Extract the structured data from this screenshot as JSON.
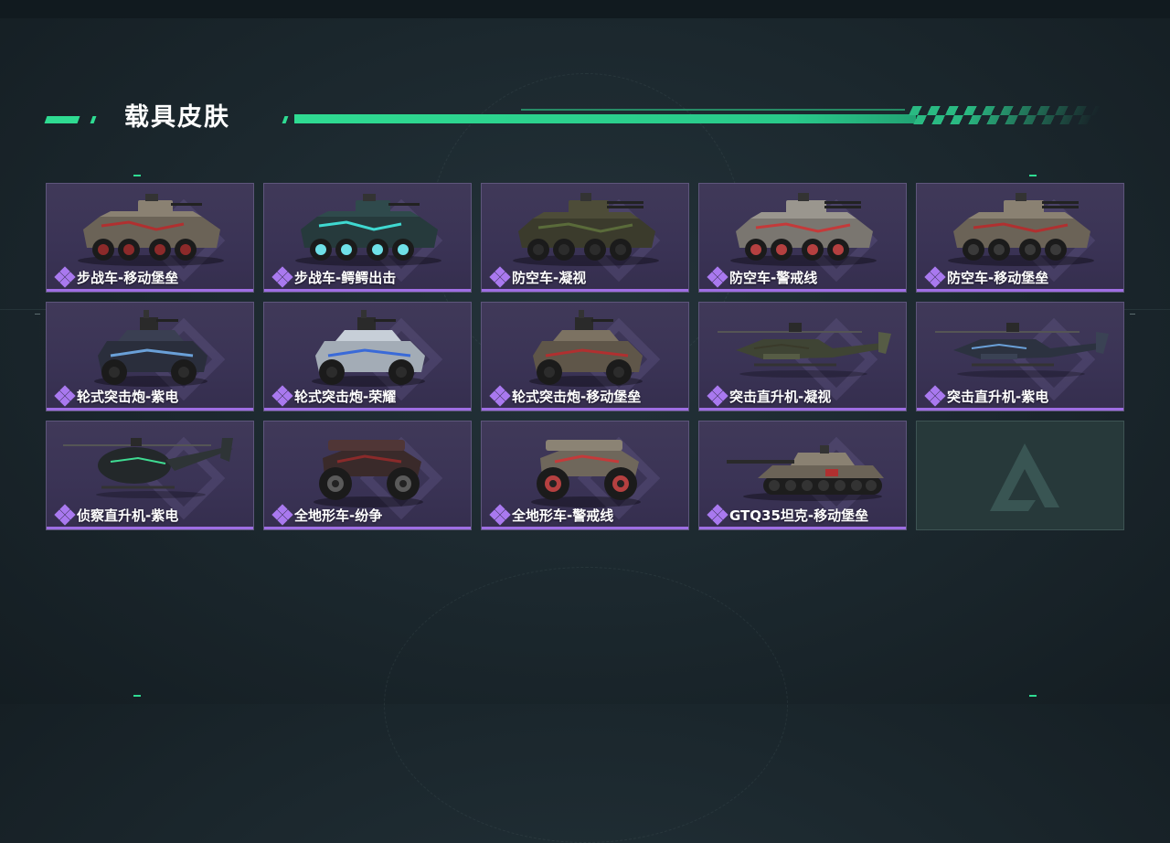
{
  "section": {
    "title": "载具皮肤"
  },
  "colors": {
    "accent": "#2fdb92",
    "rarity": "#a979ef",
    "tile_bg": "#3a3355",
    "empty_tile_bg": "#27393a"
  },
  "skins": [
    {
      "name": "步战车-移动堡垒",
      "vehicle": "ifv-8wheel-icon",
      "rarity": "epic"
    },
    {
      "name": "步战车-鳄鳄出击",
      "vehicle": "ifv-8wheel-icon",
      "rarity": "epic"
    },
    {
      "name": "防空车-凝视",
      "vehicle": "aa-vehicle-icon",
      "rarity": "epic"
    },
    {
      "name": "防空车-警戒线",
      "vehicle": "aa-vehicle-icon",
      "rarity": "epic"
    },
    {
      "name": "防空车-移动堡垒",
      "vehicle": "aa-vehicle-icon",
      "rarity": "epic"
    },
    {
      "name": "轮式突击炮-紫电",
      "vehicle": "wheeled-assault-gun-icon",
      "rarity": "epic"
    },
    {
      "name": "轮式突击炮-荣耀",
      "vehicle": "wheeled-assault-gun-icon",
      "rarity": "epic"
    },
    {
      "name": "轮式突击炮-移动堡垒",
      "vehicle": "wheeled-assault-gun-icon",
      "rarity": "epic"
    },
    {
      "name": "突击直升机-凝视",
      "vehicle": "attack-helicopter-icon",
      "rarity": "epic"
    },
    {
      "name": "突击直升机-紫电",
      "vehicle": "attack-helicopter-icon",
      "rarity": "epic"
    },
    {
      "name": "侦察直升机-紫电",
      "vehicle": "scout-helicopter-icon",
      "rarity": "epic"
    },
    {
      "name": "全地形车-纷争",
      "vehicle": "atv-icon",
      "rarity": "epic"
    },
    {
      "name": "全地形车-警戒线",
      "vehicle": "atv-icon",
      "rarity": "epic"
    },
    {
      "name": "GTQ35坦克-移动堡垒",
      "vehicle": "tank-icon",
      "rarity": "epic"
    }
  ],
  "empty_slot": {
    "icon": "game-logo-icon"
  }
}
